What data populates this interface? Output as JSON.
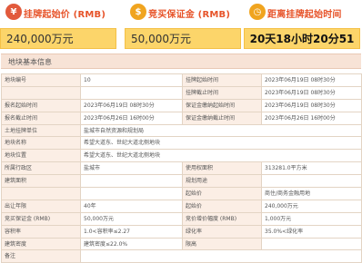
{
  "summary": {
    "start_price": {
      "label": "挂牌起始价 (RMB)",
      "value": "240,000万元",
      "icon_color": "#e25a3c"
    },
    "deposit": {
      "label": "竞买保证金 (RMB)",
      "value": "50,000万元",
      "icon_color": "#f0a41f"
    },
    "countdown": {
      "label": "距离挂牌起始时间",
      "value": "20天18小时20分51秒",
      "icon_color": "#f0a41f"
    }
  },
  "section_title": "地块基本信息",
  "rows": [
    [
      {
        "k": "地块编号",
        "v": "10",
        "span": 1
      },
      {
        "k": "挂牌起始时间",
        "v": "2023年06月19日 08时30分"
      }
    ],
    [
      {
        "k": "",
        "v": ""
      },
      {
        "k": "挂牌截止时间",
        "v": "2023年06月19日 08时30分"
      }
    ],
    [
      {
        "k": "报名起始时间",
        "v": "2023年06月19日 08时30分"
      },
      {
        "k": "保证金缴纳起始时间",
        "v": "2023年06月19日 08时30分"
      }
    ],
    [
      {
        "k": "报名截止时间",
        "v": "2023年06月26日 16时00分"
      },
      {
        "k": "保证金缴纳截止时间",
        "v": "2023年06月26日 16时00分"
      }
    ],
    [
      {
        "k": "土地挂牌单位",
        "v": "盐城市自然资源和规划局",
        "full": true
      }
    ],
    [
      {
        "k": "地块名称",
        "v": "希望大道东、世纪大道北侧地块",
        "full": true
      }
    ],
    [
      {
        "k": "地块位置",
        "v": "希望大道东、世纪大道北侧地块",
        "full": true
      }
    ],
    [
      {
        "k": "所属行政区",
        "v": "盐城市"
      },
      {
        "k": "使用权面积",
        "v": "313281.0平方米"
      }
    ],
    [
      {
        "k": "建筑面积",
        "v": ""
      },
      {
        "k": "规划用途",
        "v": ""
      }
    ],
    [
      {
        "k": "",
        "v": ""
      },
      {
        "k": "起始价",
        "v": "商住/商务金融用地"
      }
    ],
    [
      {
        "k": "出让年限",
        "v": "40年"
      },
      {
        "k": "起始价",
        "v": "240,000万元"
      }
    ],
    [
      {
        "k": "竞买保证金 (RMB)",
        "v": "50,000万元"
      },
      {
        "k": "竞价增价幅度 (RMB)",
        "v": "1,000万元"
      }
    ],
    [
      {
        "k": "容积率",
        "v": "1.0<容积率≤2.27"
      },
      {
        "k": "绿化率",
        "v": "35.0%<绿化率"
      }
    ],
    [
      {
        "k": "建筑密度",
        "v": "建筑密度≤22.0%"
      },
      {
        "k": "限高",
        "v": ""
      }
    ],
    [
      {
        "k": "备注",
        "v": "",
        "full": true
      }
    ]
  ]
}
